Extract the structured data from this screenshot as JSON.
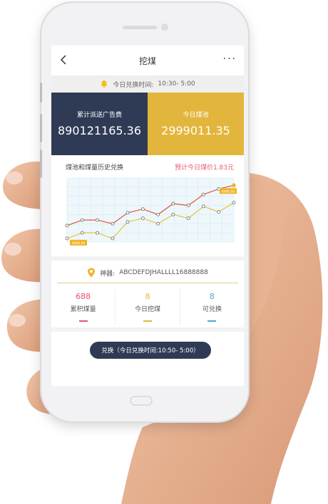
{
  "nav": {
    "title": "挖煤",
    "more": "···"
  },
  "notice": {
    "label": "今日兑换时间:",
    "time": "10:30- 5:00"
  },
  "stats": {
    "ad_fee_label": "累计派送广告费",
    "ad_fee_value": "890121165.36",
    "pool_label": "今日煤池",
    "pool_value": "2999011.35"
  },
  "chart_header": {
    "title": "煤池和煤量历史兑换",
    "price": "预计今日煤价1.83元"
  },
  "chart_data": {
    "type": "line",
    "x": [
      1,
      2,
      3,
      4,
      5,
      6,
      7,
      8,
      9,
      10,
      11,
      12
    ],
    "series": [
      {
        "color": "#e8512f",
        "values": [
          1800,
          2400,
          2400,
          2000,
          3200,
          3600,
          3000,
          4200,
          4000,
          5200,
          5800,
          6200
        ]
      },
      {
        "color": "#e8c235",
        "values": [
          400,
          1000,
          1000,
          400,
          2200,
          2600,
          2000,
          3000,
          2600,
          3900,
          3300,
          4300
        ]
      }
    ],
    "value_labels": [
      {
        "text": "4000.00"
      },
      {
        "text": "6000.00"
      }
    ],
    "grid": true
  },
  "device": {
    "label": "神器:",
    "value": "ABCDEFDJHALLLL16888888"
  },
  "kpis": [
    {
      "value": "688",
      "label": "累积煤量",
      "color": "#e8516a"
    },
    {
      "value": "8",
      "label": "今日挖煤",
      "color": "#e2b63c"
    },
    {
      "value": "8",
      "label": "可兑换",
      "color": "#4aa8d8"
    }
  ],
  "exchange": {
    "label": "兑换（今日兑换时间:10:50- 5:00）"
  }
}
